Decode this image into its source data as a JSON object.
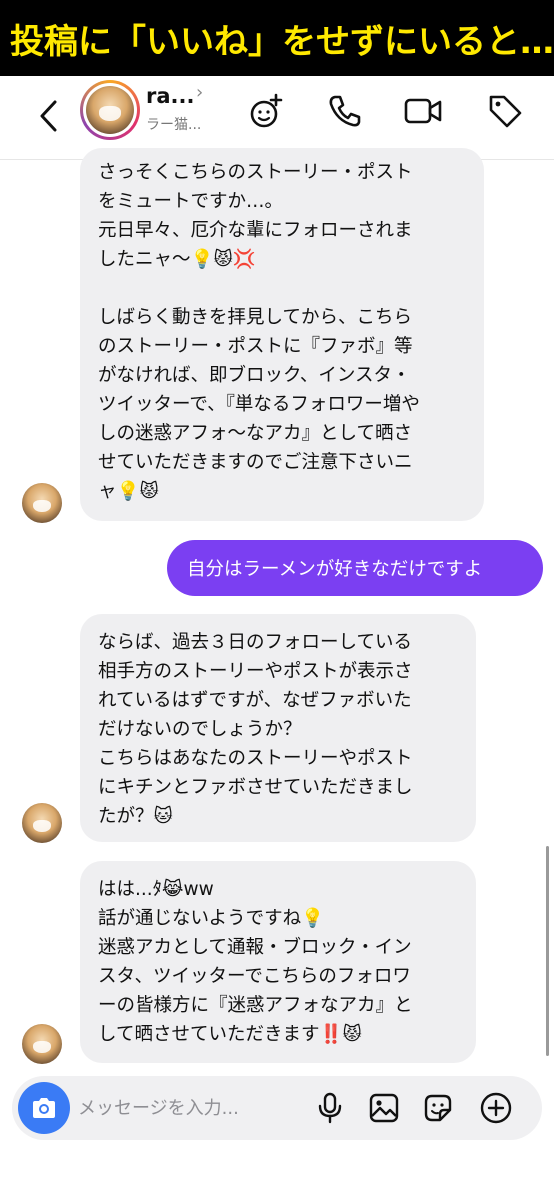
{
  "caption": "投稿に「いいね」をせずにいると…",
  "header": {
    "username": "ra...",
    "subtitle": "ラー猫..."
  },
  "messages": [
    {
      "side": "incoming",
      "lines": [
        "さっそくこちらのストーリー・ポスト",
        "をミュートですか…。",
        "元日早々、厄介な輩にフォローされま",
        "したニャ〜💡😾💢",
        "",
        "しばらく動きを拝見してから、こちら",
        "のストーリー・ポストに『ファボ』等",
        "がなければ、即ブロック、インスタ・",
        "ツイッターで、『単なるフォロワー増や",
        "しの迷惑アフォ〜なアカ』として晒さ",
        "せていただきますのでご注意下さいニ",
        "ャ💡😾"
      ]
    },
    {
      "side": "outgoing",
      "text": "自分はラーメンが好きなだけですよ"
    },
    {
      "side": "incoming",
      "lines": [
        "ならば、過去３日のフォローしている",
        "相手方のストーリーやポストが表示さ",
        "れているはずですが、なぜファボいた",
        "だけないのでしょうか？",
        "こちらはあなたのストーリーやポスト",
        "にキチンとファボさせていただきまし",
        "たが？🐱"
      ]
    },
    {
      "side": "incoming",
      "lines": [
        "はは...ﾀ😹ww",
        "話が通じないようですね💡",
        "迷惑アカとして通報・ブロック・イン",
        "スタ、ツイッターでこちらのフォロワ",
        "ーの皆様方に『迷惑アフォなアカ』と",
        "して晒させていただきます‼️😾"
      ]
    }
  ],
  "composer": {
    "placeholder": "メッセージを入力..."
  },
  "icons": {
    "back": "chevron-left-icon",
    "effects": "sticker-effects-icon",
    "call": "phone-icon",
    "video": "video-camera-icon",
    "tag": "tag-icon",
    "camera": "camera-icon",
    "mic": "microphone-icon",
    "gallery": "image-icon",
    "sticker": "sticker-icon",
    "add": "plus-circle-icon"
  },
  "colors": {
    "outgoing_bubble": "#7b3ff2",
    "incoming_bubble": "#efeff1",
    "camera_button": "#3a7bf5",
    "caption_text": "#ffe900"
  }
}
